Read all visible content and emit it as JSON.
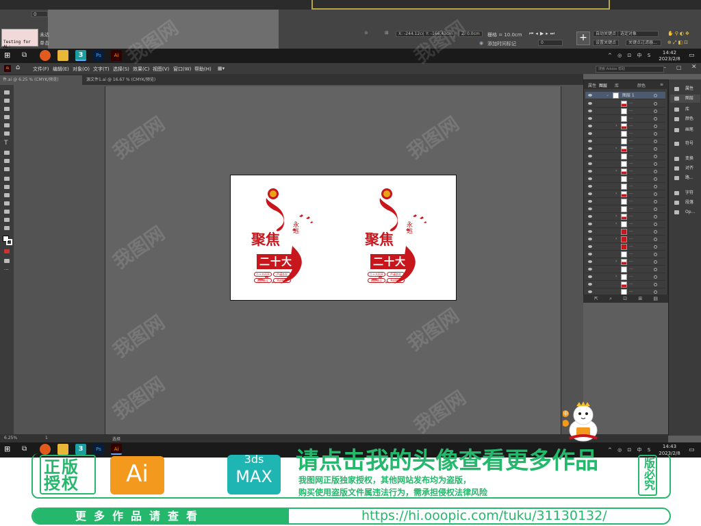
{
  "top_strip": {
    "frame_field": "0",
    "test_box_label": "Testing for AL:",
    "side_labels": [
      "未达",
      "单击"
    ],
    "coord_x": "X: -244.12cm",
    "coord_y": "Y: -166.43cm",
    "coord_z": "Z: 0.0cm",
    "grid": "栅格 = 10.0cm",
    "add_time_tag": "添加时间标记",
    "auto_key": "自动关键点",
    "set_key": "设置关键点",
    "selected_object": "选定对象",
    "key_filters": "关键点过滤器...",
    "frame_value": "0"
  },
  "taskbar_top": {
    "time": "14:42",
    "date": "2023/2/8",
    "ime": "中"
  },
  "taskbar_bottom": {
    "time": "14:43",
    "date": "2023/2/8",
    "ime": "中"
  },
  "menubar": {
    "items": [
      "文件(F)",
      "编辑(E)",
      "对象(O)",
      "文字(T)",
      "选择(S)",
      "效果(C)",
      "视图(V)",
      "窗口(W)",
      "帮助(H)"
    ],
    "search_placeholder": "搜索 Adobe 帮助"
  },
  "tabs": [
    {
      "label": "件.ai @ 6.25 % (CMYK/预览)"
    },
    {
      "label": "源文件1.ai @ 16.67 % (CMYK/预览)"
    }
  ],
  "statusbar": {
    "zoom": "6.25%",
    "artboard": "1",
    "tool": "选择"
  },
  "layers_panel": {
    "tabs": [
      "属性",
      "图层",
      "库",
      "颜色"
    ],
    "top_layer": "图层 1",
    "row_count": 26
  },
  "right_dock": {
    "items": [
      "属性",
      "图层",
      "库",
      "颜色",
      "画笔",
      "符号",
      "变换",
      "对齐",
      "路...",
      "字符",
      "段落",
      "Op..."
    ]
  },
  "poster": {
    "title": "聚焦",
    "main": "二十大",
    "vertical_text": "永远",
    "pill_texts": [
      "二十大召开",
      "严谨务实",
      "团结奋斗",
      "共创辉煌"
    ]
  },
  "mascot": {
    "badge_text": "中"
  },
  "banner": {
    "stamp_left": "正版授权",
    "ai_badge": "Ai",
    "max_badge_top": "3ds",
    "max_badge": "MAX",
    "headline": "请点击我的头像查看更多作品",
    "line1": "我图网正版独家授权，其他网站发布均为盗版，",
    "line2": "购买使用盗版文件属违法行为，需承担侵权法律风险",
    "stamp_right": "版必究",
    "more_works": "更多作品请查看",
    "url": "https://hi.ooopic.com/tuku/31130132/"
  },
  "watermark_text": "我图网",
  "colors": {
    "accent_green": "#25b76b",
    "poster_red": "#c8161d",
    "ai_orange": "#f39a1e",
    "max_teal": "#1fb5b2"
  }
}
